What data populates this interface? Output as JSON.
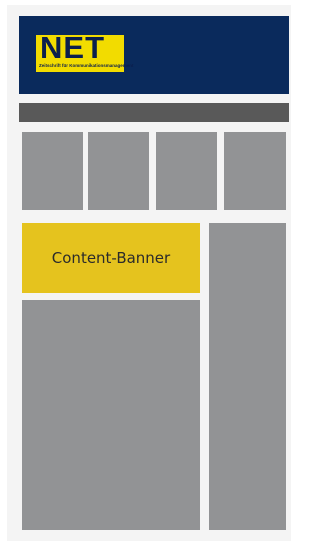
{
  "header": {
    "logo_main": "NET",
    "logo_sub": "Zeitschrift für Kommunikationsmanagement"
  },
  "banner": {
    "label": "Content-Banner"
  },
  "colors": {
    "header_bg": "#0a2a5c",
    "logo_bg": "#f2dc00",
    "nav_bg": "#595959",
    "placeholder": "#929395",
    "banner_bg": "#e5c31e"
  }
}
